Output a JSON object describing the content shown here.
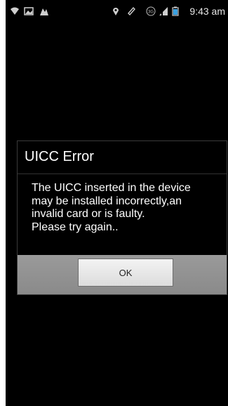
{
  "status_bar": {
    "time": "9:43 am",
    "network_badge": "3G",
    "icons": [
      "wifi-icon",
      "image-icon",
      "notification-icon",
      "location-pin-icon",
      "sync-icon",
      "network-3g-icon",
      "signal-icon",
      "battery-icon"
    ]
  },
  "dialog": {
    "title": "UICC Error",
    "message_lines": [
      "The UICC inserted in the device",
      "may be installed incorrectly,an",
      "invalid card or is faulty.",
      "Please try again.."
    ],
    "ok_label": "OK"
  },
  "colors": {
    "background": "#000000",
    "text": "#ffffff",
    "button_bar": "#8e8e8e",
    "button": "#e8e8e8"
  }
}
